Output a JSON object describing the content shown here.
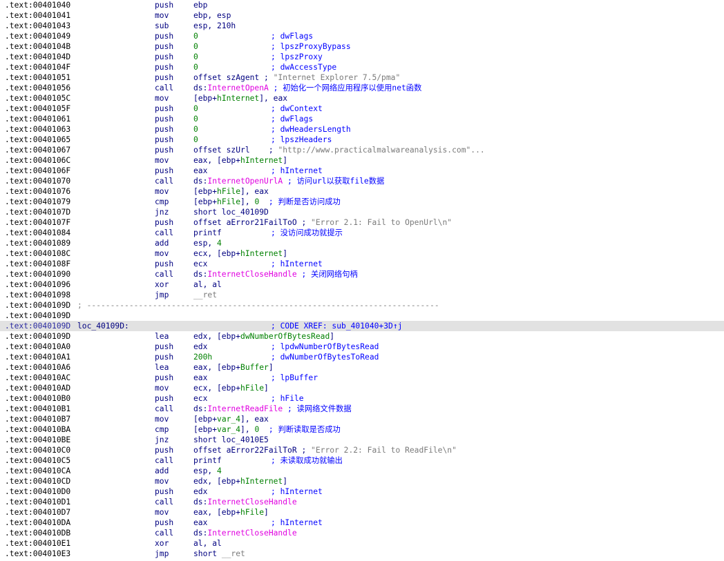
{
  "listing": {
    "lines": [
      {
        "addr": ".text:00401040",
        "mnem": "push",
        "ops": [
          {
            "t": "ebp",
            "c": "plain"
          }
        ]
      },
      {
        "addr": ".text:00401041",
        "mnem": "mov",
        "ops": [
          {
            "t": "ebp, esp",
            "c": "plain"
          }
        ]
      },
      {
        "addr": ".text:00401043",
        "mnem": "sub",
        "ops": [
          {
            "t": "esp, 210h",
            "c": "plain"
          }
        ]
      },
      {
        "addr": ".text:00401049",
        "mnem": "push",
        "ops": [
          {
            "t": "0",
            "c": "num"
          }
        ],
        "comment": "; dwFlags"
      },
      {
        "addr": ".text:0040104B",
        "mnem": "push",
        "ops": [
          {
            "t": "0",
            "c": "num"
          }
        ],
        "comment": "; lpszProxyBypass"
      },
      {
        "addr": ".text:0040104D",
        "mnem": "push",
        "ops": [
          {
            "t": "0",
            "c": "num"
          }
        ],
        "comment": "; lpszProxy"
      },
      {
        "addr": ".text:0040104F",
        "mnem": "push",
        "ops": [
          {
            "t": "0",
            "c": "num"
          }
        ],
        "comment": "; dwAccessType"
      },
      {
        "addr": ".text:00401051",
        "mnem": "push",
        "ops": [
          {
            "t": "offset szAgent",
            "c": "plain"
          },
          {
            "t": " ; ",
            "c": "plain"
          },
          {
            "t": "\"Internet Explorer 7.5/pma\"",
            "c": "str"
          }
        ]
      },
      {
        "addr": ".text:00401056",
        "mnem": "call",
        "ops": [
          {
            "t": "ds:",
            "c": "plain"
          },
          {
            "t": "InternetOpenA",
            "c": "api"
          },
          {
            "t": " ; 初始化一个网络应用程序以使用net函数",
            "c": "cmt"
          }
        ]
      },
      {
        "addr": ".text:0040105C",
        "mnem": "mov",
        "ops": [
          {
            "t": "[ebp+",
            "c": "plain"
          },
          {
            "t": "hInternet",
            "c": "var"
          },
          {
            "t": "], eax",
            "c": "plain"
          }
        ]
      },
      {
        "addr": ".text:0040105F",
        "mnem": "push",
        "ops": [
          {
            "t": "0",
            "c": "num"
          }
        ],
        "comment": "; dwContext"
      },
      {
        "addr": ".text:00401061",
        "mnem": "push",
        "ops": [
          {
            "t": "0",
            "c": "num"
          }
        ],
        "comment": "; dwFlags"
      },
      {
        "addr": ".text:00401063",
        "mnem": "push",
        "ops": [
          {
            "t": "0",
            "c": "num"
          }
        ],
        "comment": "; dwHeadersLength"
      },
      {
        "addr": ".text:00401065",
        "mnem": "push",
        "ops": [
          {
            "t": "0",
            "c": "num"
          }
        ],
        "comment": "; lpszHeaders"
      },
      {
        "addr": ".text:00401067",
        "mnem": "push",
        "ops": [
          {
            "t": "offset szUrl",
            "c": "plain"
          },
          {
            "t": "    ; ",
            "c": "plain"
          },
          {
            "t": "\"http://www.practicalmalwareanalysis.com\"...",
            "c": "str"
          }
        ]
      },
      {
        "addr": ".text:0040106C",
        "mnem": "mov",
        "ops": [
          {
            "t": "eax, [ebp+",
            "c": "plain"
          },
          {
            "t": "hInternet",
            "c": "var"
          },
          {
            "t": "]",
            "c": "plain"
          }
        ]
      },
      {
        "addr": ".text:0040106F",
        "mnem": "push",
        "ops": [
          {
            "t": "eax",
            "c": "plain"
          }
        ],
        "comment": "; hInternet"
      },
      {
        "addr": ".text:00401070",
        "mnem": "call",
        "ops": [
          {
            "t": "ds:",
            "c": "plain"
          },
          {
            "t": "InternetOpenUrlA",
            "c": "api"
          },
          {
            "t": " ; 访问url以获取file数据",
            "c": "cmt"
          }
        ]
      },
      {
        "addr": ".text:00401076",
        "mnem": "mov",
        "ops": [
          {
            "t": "[ebp+",
            "c": "plain"
          },
          {
            "t": "hFile",
            "c": "var"
          },
          {
            "t": "], eax",
            "c": "plain"
          }
        ]
      },
      {
        "addr": ".text:00401079",
        "mnem": "cmp",
        "ops": [
          {
            "t": "[ebp+",
            "c": "plain"
          },
          {
            "t": "hFile",
            "c": "var"
          },
          {
            "t": "], ",
            "c": "plain"
          },
          {
            "t": "0",
            "c": "num"
          },
          {
            "t": "  ; 判断是否访问成功",
            "c": "cmt"
          }
        ]
      },
      {
        "addr": ".text:0040107D",
        "mnem": "jnz",
        "ops": [
          {
            "t": "short loc_40109D",
            "c": "plain"
          }
        ]
      },
      {
        "addr": ".text:0040107F",
        "mnem": "push",
        "ops": [
          {
            "t": "offset aError21FailToO",
            "c": "plain"
          },
          {
            "t": " ; ",
            "c": "plain"
          },
          {
            "t": "\"Error 2.1: Fail to OpenUrl\\n\"",
            "c": "str"
          }
        ]
      },
      {
        "addr": ".text:00401084",
        "mnem": "call",
        "ops": [
          {
            "t": "printf",
            "c": "plain"
          }
        ],
        "comment": "; 没访问成功就提示"
      },
      {
        "addr": ".text:00401089",
        "mnem": "add",
        "ops": [
          {
            "t": "esp, ",
            "c": "plain"
          },
          {
            "t": "4",
            "c": "num"
          }
        ]
      },
      {
        "addr": ".text:0040108C",
        "mnem": "mov",
        "ops": [
          {
            "t": "ecx, [ebp+",
            "c": "plain"
          },
          {
            "t": "hInternet",
            "c": "var"
          },
          {
            "t": "]",
            "c": "plain"
          }
        ]
      },
      {
        "addr": ".text:0040108F",
        "mnem": "push",
        "ops": [
          {
            "t": "ecx",
            "c": "plain"
          }
        ],
        "comment": "; hInternet"
      },
      {
        "addr": ".text:00401090",
        "mnem": "call",
        "ops": [
          {
            "t": "ds:",
            "c": "plain"
          },
          {
            "t": "InternetCloseHandle",
            "c": "api"
          },
          {
            "t": " ; 关闭网络句柄",
            "c": "cmt"
          }
        ]
      },
      {
        "addr": ".text:00401096",
        "mnem": "xor",
        "ops": [
          {
            "t": "al, al",
            "c": "plain"
          }
        ]
      },
      {
        "addr": ".text:00401098",
        "mnem": "jmp",
        "ops": [
          {
            "t": "__ret",
            "c": "str"
          }
        ]
      },
      {
        "addr": ".text:0040109D",
        "sep": "; ---------------------------------------------------------------------------"
      },
      {
        "addr": ".text:0040109D"
      },
      {
        "addr": ".text:0040109D",
        "highlight": true,
        "label": "loc_40109D:",
        "comment": "; CODE XREF: sub_401040+3D↑j"
      },
      {
        "addr": ".text:0040109D",
        "mnem": "lea",
        "ops": [
          {
            "t": "edx, [ebp+",
            "c": "plain"
          },
          {
            "t": "dwNumberOfBytesRead",
            "c": "var"
          },
          {
            "t": "]",
            "c": "plain"
          }
        ]
      },
      {
        "addr": ".text:004010A0",
        "mnem": "push",
        "ops": [
          {
            "t": "edx",
            "c": "plain"
          }
        ],
        "comment": "; lpdwNumberOfBytesRead"
      },
      {
        "addr": ".text:004010A1",
        "mnem": "push",
        "ops": [
          {
            "t": "200h",
            "c": "num"
          }
        ],
        "comment": "; dwNumberOfBytesToRead"
      },
      {
        "addr": ".text:004010A6",
        "mnem": "lea",
        "ops": [
          {
            "t": "eax, [ebp+",
            "c": "plain"
          },
          {
            "t": "Buffer",
            "c": "var"
          },
          {
            "t": "]",
            "c": "plain"
          }
        ]
      },
      {
        "addr": ".text:004010AC",
        "mnem": "push",
        "ops": [
          {
            "t": "eax",
            "c": "plain"
          }
        ],
        "comment": "; lpBuffer"
      },
      {
        "addr": ".text:004010AD",
        "mnem": "mov",
        "ops": [
          {
            "t": "ecx, [ebp+",
            "c": "plain"
          },
          {
            "t": "hFile",
            "c": "var"
          },
          {
            "t": "]",
            "c": "plain"
          }
        ]
      },
      {
        "addr": ".text:004010B0",
        "mnem": "push",
        "ops": [
          {
            "t": "ecx",
            "c": "plain"
          }
        ],
        "comment": "; hFile"
      },
      {
        "addr": ".text:004010B1",
        "mnem": "call",
        "ops": [
          {
            "t": "ds:",
            "c": "plain"
          },
          {
            "t": "InternetReadFile",
            "c": "api"
          },
          {
            "t": " ; 读网络文件数据",
            "c": "cmt"
          }
        ]
      },
      {
        "addr": ".text:004010B7",
        "mnem": "mov",
        "ops": [
          {
            "t": "[ebp+",
            "c": "plain"
          },
          {
            "t": "var_4",
            "c": "var"
          },
          {
            "t": "], eax",
            "c": "plain"
          }
        ]
      },
      {
        "addr": ".text:004010BA",
        "mnem": "cmp",
        "ops": [
          {
            "t": "[ebp+",
            "c": "plain"
          },
          {
            "t": "var_4",
            "c": "var"
          },
          {
            "t": "], ",
            "c": "plain"
          },
          {
            "t": "0",
            "c": "num"
          },
          {
            "t": "  ; 判断读取是否成功",
            "c": "cmt"
          }
        ]
      },
      {
        "addr": ".text:004010BE",
        "mnem": "jnz",
        "ops": [
          {
            "t": "short loc_4010E5",
            "c": "plain"
          }
        ]
      },
      {
        "addr": ".text:004010C0",
        "mnem": "push",
        "ops": [
          {
            "t": "offset aError22FailToR",
            "c": "plain"
          },
          {
            "t": " ; ",
            "c": "plain"
          },
          {
            "t": "\"Error 2.2: Fail to ReadFile\\n\"",
            "c": "str"
          }
        ]
      },
      {
        "addr": ".text:004010C5",
        "mnem": "call",
        "ops": [
          {
            "t": "printf",
            "c": "plain"
          }
        ],
        "comment": "; 未读取成功就输出"
      },
      {
        "addr": ".text:004010CA",
        "mnem": "add",
        "ops": [
          {
            "t": "esp, ",
            "c": "plain"
          },
          {
            "t": "4",
            "c": "num"
          }
        ]
      },
      {
        "addr": ".text:004010CD",
        "mnem": "mov",
        "ops": [
          {
            "t": "edx, [ebp+",
            "c": "plain"
          },
          {
            "t": "hInternet",
            "c": "var"
          },
          {
            "t": "]",
            "c": "plain"
          }
        ]
      },
      {
        "addr": ".text:004010D0",
        "mnem": "push",
        "ops": [
          {
            "t": "edx",
            "c": "plain"
          }
        ],
        "comment": "; hInternet"
      },
      {
        "addr": ".text:004010D1",
        "mnem": "call",
        "ops": [
          {
            "t": "ds:",
            "c": "plain"
          },
          {
            "t": "InternetCloseHandle",
            "c": "api"
          }
        ]
      },
      {
        "addr": ".text:004010D7",
        "mnem": "mov",
        "ops": [
          {
            "t": "eax, [ebp+",
            "c": "plain"
          },
          {
            "t": "hFile",
            "c": "var"
          },
          {
            "t": "]",
            "c": "plain"
          }
        ]
      },
      {
        "addr": ".text:004010DA",
        "mnem": "push",
        "ops": [
          {
            "t": "eax",
            "c": "plain"
          }
        ],
        "comment": "; hInternet"
      },
      {
        "addr": ".text:004010DB",
        "mnem": "call",
        "ops": [
          {
            "t": "ds:",
            "c": "plain"
          },
          {
            "t": "InternetCloseHandle",
            "c": "api"
          }
        ]
      },
      {
        "addr": ".text:004010E1",
        "mnem": "xor",
        "ops": [
          {
            "t": "al, al",
            "c": "plain"
          }
        ]
      },
      {
        "addr": ".text:004010E3",
        "mnem": "jmp",
        "ops": [
          {
            "t": "short ",
            "c": "plain"
          },
          {
            "t": "__ret",
            "c": "str"
          }
        ]
      }
    ]
  }
}
